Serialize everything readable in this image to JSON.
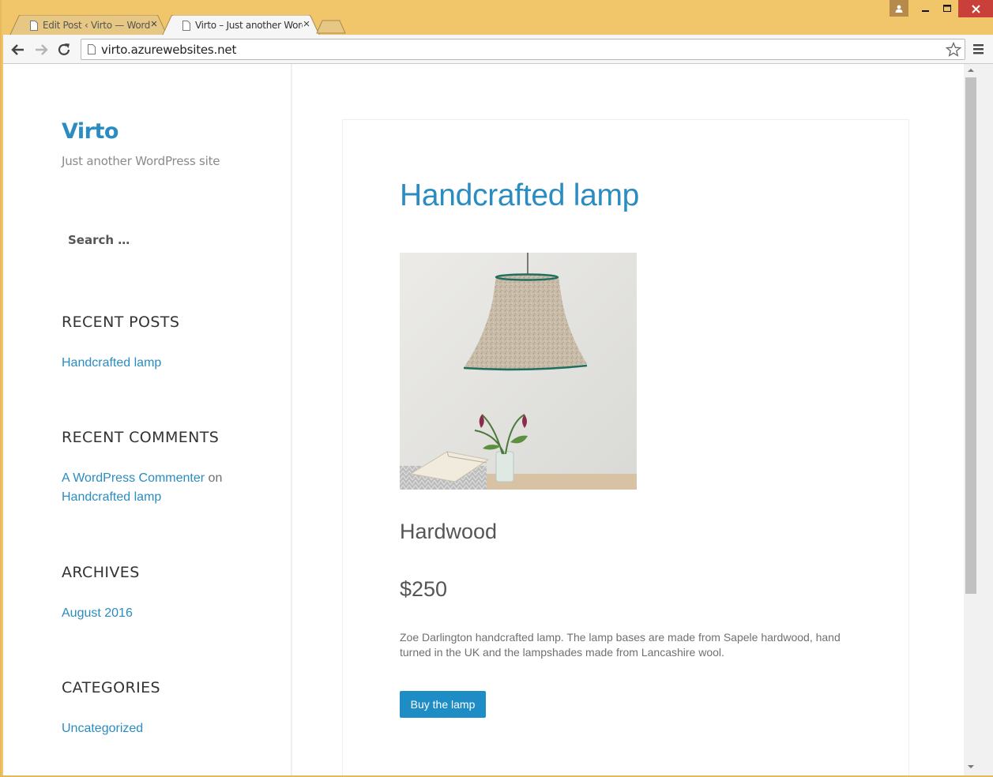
{
  "browser": {
    "tabs": [
      {
        "title": "Edit Post ‹ Virto — WordPress",
        "active": false
      },
      {
        "title": "Virto – Just another WordPress site",
        "active": true
      }
    ],
    "url": "virto.azurewebsites.net",
    "accent_color": "#f1c66a"
  },
  "sidebar": {
    "site_title": "Virto",
    "site_description": "Just another WordPress site",
    "search_placeholder": "Search …",
    "widgets": {
      "recent_posts": {
        "title": "RECENT POSTS",
        "items": [
          "Handcrafted lamp"
        ]
      },
      "recent_comments": {
        "title": "RECENT COMMENTS",
        "author": "A WordPress Commenter",
        "connector": "on",
        "post": "Handcrafted lamp"
      },
      "archives": {
        "title": "ARCHIVES",
        "items": [
          "August 2016"
        ]
      },
      "categories": {
        "title": "CATEGORIES",
        "items": [
          "Uncategorized"
        ]
      }
    }
  },
  "post": {
    "title": "Handcrafted lamp",
    "material": "Hardwood",
    "price": "$250",
    "description": "Zoe Darlington handcrafted lamp. The lamp bases are made from Sapele hardwood, hand turned in the UK and the lampshades made from Lancashire wool.",
    "buy_label": "Buy the lamp"
  },
  "colors": {
    "link": "#2a8cc0",
    "button": "#1e8cc5"
  }
}
